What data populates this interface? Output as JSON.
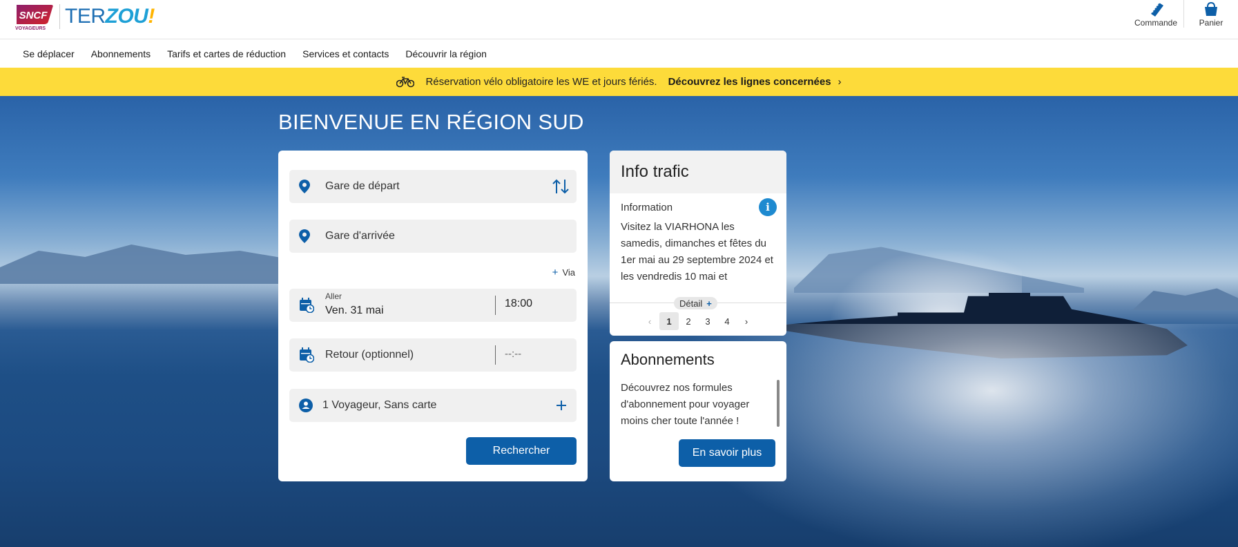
{
  "header": {
    "logo": {
      "brand": "SNCF",
      "sub": "VOYAGEURS",
      "ter_part1": "TER",
      "ter_part2": "ZOU",
      "ter_part3": "!"
    },
    "commande_label": "Commande",
    "panier_label": "Panier"
  },
  "nav": {
    "items": [
      "Se déplacer",
      "Abonnements",
      "Tarifs et cartes de réduction",
      "Services et contacts",
      "Découvrir la région"
    ]
  },
  "banner": {
    "message": "Réservation vélo obligatoire les WE et jours fériés.",
    "link": "Découvrez les lignes concernées",
    "color": "#fddb3a"
  },
  "hero": {
    "title": "BIENVENUE EN RÉGION SUD"
  },
  "search": {
    "departure_placeholder": "Gare de départ",
    "arrival_placeholder": "Gare d'arrivée",
    "via_label": "Via",
    "aller_label": "Aller",
    "aller_date": "Ven. 31 mai",
    "aller_time": "18:00",
    "retour_placeholder": "Retour (optionnel)",
    "retour_time": "--:--",
    "travellers": "1 Voyageur, Sans carte",
    "submit_label": "Rechercher",
    "accent_color": "#0d5fa8"
  },
  "info_trafic": {
    "title": "Info trafic",
    "subtitle": "Information",
    "text": "Visitez la  VIARHONA les samedis, dimanches et fêtes du 1er mai au 29 septembre 2024 et les vendredis 10 mai et",
    "detail_label": "Détail",
    "pages": [
      "1",
      "2",
      "3",
      "4"
    ],
    "current_page": "1"
  },
  "abonnements": {
    "title": "Abonnements",
    "text": "Découvrez nos formules d'abonnement pour voyager moins cher toute l'année !",
    "button_label": "En savoir plus"
  }
}
